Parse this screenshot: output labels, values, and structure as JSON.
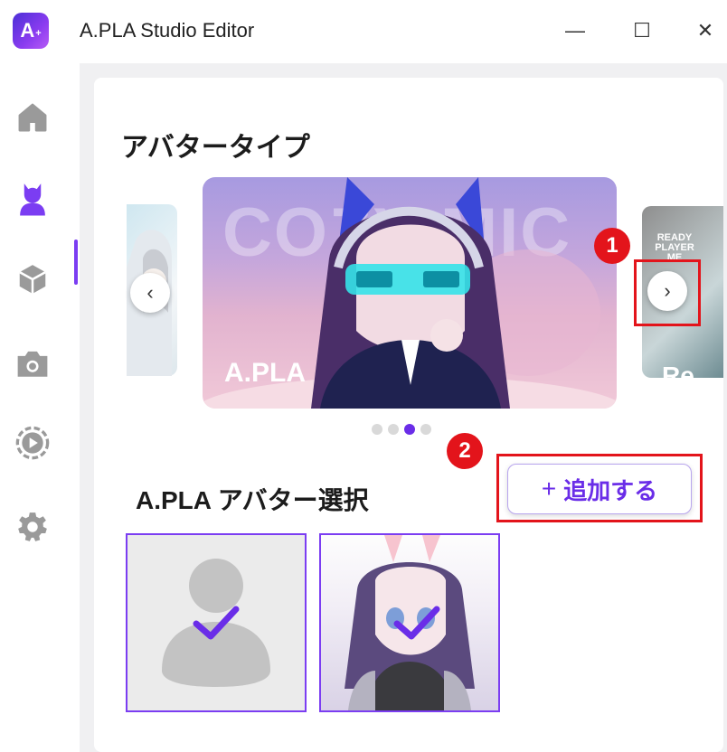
{
  "window": {
    "title": "A.PLA Studio Editor",
    "logo_text": "A",
    "logo_plus": "+",
    "controls": {
      "minimize": "—",
      "maximize": "☐",
      "close": "✕"
    }
  },
  "sidebar": {
    "items": [
      {
        "name": "home",
        "icon": "home-icon"
      },
      {
        "name": "avatar",
        "icon": "avatar-icon",
        "active": true
      },
      {
        "name": "item",
        "icon": "cube-icon"
      },
      {
        "name": "camera",
        "icon": "camera-icon"
      },
      {
        "name": "motion",
        "icon": "play-circle-icon"
      },
      {
        "name": "settings",
        "icon": "gear-icon"
      }
    ]
  },
  "avatar_type": {
    "title": "アバタータイプ",
    "slides": [
      {
        "label": "",
        "position": "previous"
      },
      {
        "label": "A.PLA",
        "brand_text": "COZY   MIC",
        "position": "current"
      },
      {
        "label": "Re",
        "brand_text": "READY PLAYER ME",
        "position": "next"
      }
    ],
    "prev_arrow": "‹",
    "next_arrow": "›",
    "page_count": 4,
    "active_page": 3
  },
  "avatar_select": {
    "title": "A.PLA アバター選択",
    "add_button": {
      "plus": "+",
      "label": "追加する"
    },
    "cards": [
      {
        "name": "default",
        "selected": true
      },
      {
        "name": "bunny-girl",
        "selected": true
      }
    ]
  },
  "annotations": [
    {
      "number": "1",
      "target": "next-arrow"
    },
    {
      "number": "2",
      "target": "add-button"
    }
  ],
  "colors": {
    "accent": "#7b3df2",
    "accent_dark": "#6a2de8",
    "annotation_red": "#e3141b"
  }
}
